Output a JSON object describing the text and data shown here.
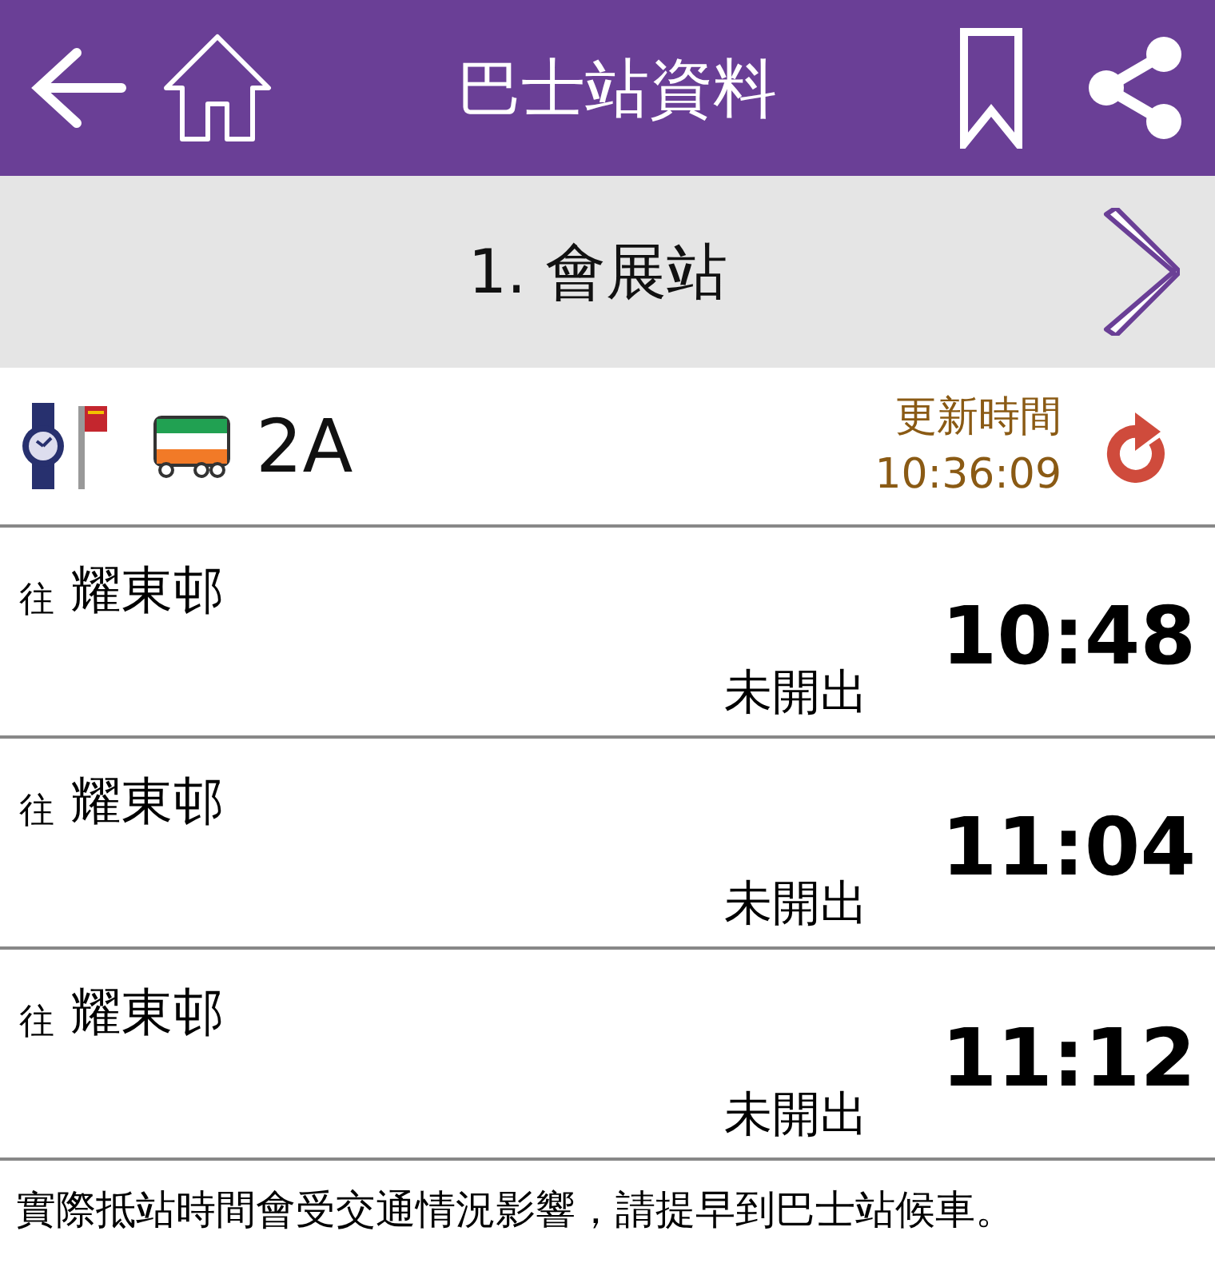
{
  "header": {
    "title": "巴士站資料"
  },
  "station": {
    "name": "1. 會展站"
  },
  "route": {
    "number": "2A",
    "update_label": "更新時間",
    "update_time": "10:36:09"
  },
  "departures": [
    {
      "prefix": "往",
      "destination": "耀東邨",
      "status": "未開出",
      "time": "10:48"
    },
    {
      "prefix": "往",
      "destination": "耀東邨",
      "status": "未開出",
      "time": "11:04"
    },
    {
      "prefix": "往",
      "destination": "耀東邨",
      "status": "未開出",
      "time": "11:12"
    }
  ],
  "notice": "實際抵站時間會受交通情況影響，請提早到巴士站候車。"
}
